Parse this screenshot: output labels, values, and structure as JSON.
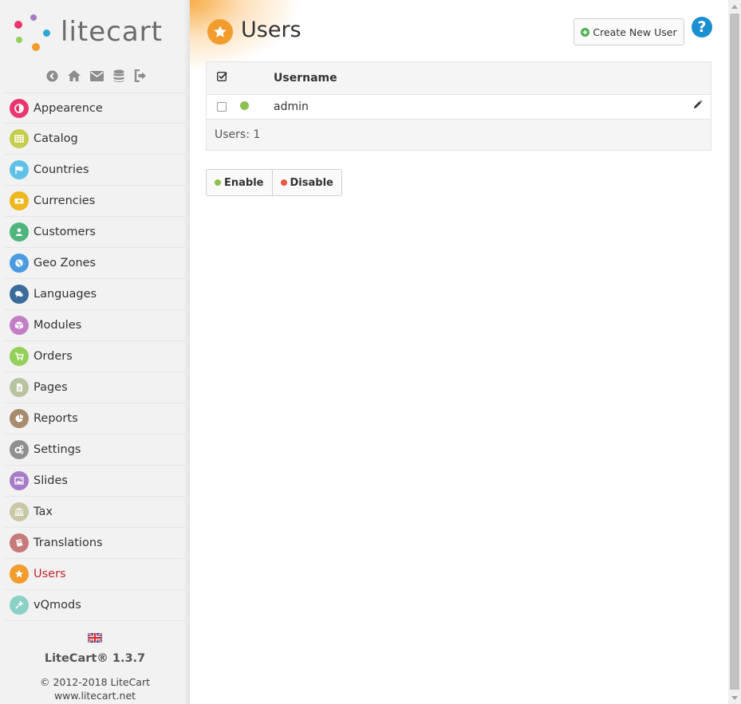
{
  "sidebar": {
    "logo_text": "litecart",
    "menu": [
      {
        "label": "Appearence",
        "icon": "contrast-icon",
        "color": "#e8376e"
      },
      {
        "label": "Catalog",
        "icon": "grid-icon",
        "color": "#c5cd4a"
      },
      {
        "label": "Countries",
        "icon": "flag-icon",
        "color": "#5ec1e8"
      },
      {
        "label": "Currencies",
        "icon": "money-icon",
        "color": "#f0b81f"
      },
      {
        "label": "Customers",
        "icon": "user-icon",
        "color": "#4fb57d"
      },
      {
        "label": "Geo Zones",
        "icon": "globe-icon",
        "color": "#4a9be0"
      },
      {
        "label": "Languages",
        "icon": "comments-icon",
        "color": "#3b6b9c"
      },
      {
        "label": "Modules",
        "icon": "cube-icon",
        "color": "#c47ec6"
      },
      {
        "label": "Orders",
        "icon": "cart-icon",
        "color": "#94d15a"
      },
      {
        "label": "Pages",
        "icon": "document-icon",
        "color": "#b8c4a0"
      },
      {
        "label": "Reports",
        "icon": "pie-chart-icon",
        "color": "#a88a6d"
      },
      {
        "label": "Settings",
        "icon": "cogs-icon",
        "color": "#8f8f8f"
      },
      {
        "label": "Slides",
        "icon": "image-icon",
        "color": "#a67cc9"
      },
      {
        "label": "Tax",
        "icon": "bank-icon",
        "color": "#c9c7a4"
      },
      {
        "label": "Translations",
        "icon": "book-icon",
        "color": "#c77a7a"
      },
      {
        "label": "Users",
        "icon": "star-icon",
        "color": "#f39c2e",
        "active": true
      },
      {
        "label": "vQmods",
        "icon": "plug-icon",
        "color": "#8ad1c8"
      }
    ],
    "platform": "LiteCart® 1.3.7",
    "copyright": "© 2012-2018 LiteCart",
    "website": "www.litecart.net"
  },
  "page": {
    "title": "Users",
    "create_button": "Create New User",
    "help": "?"
  },
  "table": {
    "header": {
      "username": "Username"
    },
    "rows": [
      {
        "username": "admin",
        "status_color": "#8cc152"
      }
    ],
    "footer": "Users: 1"
  },
  "actions": {
    "enable": "Enable",
    "disable": "Disable",
    "enable_color": "#8cc152",
    "disable_color": "#e9573f"
  },
  "colors": {
    "accent": "#f39c2e",
    "active_menu": "#c0262c",
    "help": "#1a8fd1"
  }
}
